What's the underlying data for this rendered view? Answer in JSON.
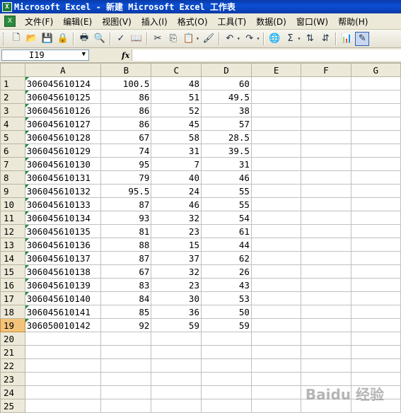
{
  "window": {
    "title": "Microsoft Excel - 新建 Microsoft Excel 工作表"
  },
  "menubar": {
    "items": [
      "文件(F)",
      "编辑(E)",
      "视图(V)",
      "插入(I)",
      "格式(O)",
      "工具(T)",
      "数据(D)",
      "窗口(W)",
      "帮助(H)"
    ]
  },
  "toolbar": {
    "buttons": [
      {
        "name": "new-icon",
        "glyph": "🗋"
      },
      {
        "name": "open-icon",
        "glyph": "📂"
      },
      {
        "name": "save-icon",
        "glyph": "💾"
      },
      {
        "name": "permission-icon",
        "glyph": "🔒"
      },
      {
        "name": "print-icon",
        "glyph": "🖶"
      },
      {
        "name": "print-preview-icon",
        "glyph": "🔍"
      },
      {
        "name": "spelling-icon",
        "glyph": "✓"
      },
      {
        "name": "research-icon",
        "glyph": "📖"
      },
      {
        "name": "cut-icon",
        "glyph": "✂"
      },
      {
        "name": "copy-icon",
        "glyph": "⎘"
      },
      {
        "name": "paste-icon",
        "glyph": "📋"
      },
      {
        "name": "format-painter-icon",
        "glyph": "🖌"
      },
      {
        "name": "undo-icon",
        "glyph": "↶"
      },
      {
        "name": "redo-icon",
        "glyph": "↷"
      },
      {
        "name": "hyperlink-icon",
        "glyph": "🌐"
      },
      {
        "name": "autosum-icon",
        "glyph": "Σ"
      },
      {
        "name": "sort-ascending-icon",
        "glyph": "⇅"
      },
      {
        "name": "sort-descending-icon",
        "glyph": "⇵"
      },
      {
        "name": "chart-wizard-icon",
        "glyph": "📊"
      },
      {
        "name": "drawing-icon",
        "glyph": "✎"
      }
    ]
  },
  "formula_bar": {
    "name_box": "I19",
    "fx_label": "fx",
    "value": ""
  },
  "sheet": {
    "columns": [
      "A",
      "B",
      "C",
      "D",
      "E",
      "F",
      "G"
    ],
    "selected_row": 19,
    "rows": [
      {
        "row": "1",
        "A": "306045610124",
        "B": "100.5",
        "C": "48",
        "D": "60"
      },
      {
        "row": "2",
        "A": "306045610125",
        "B": "86",
        "C": "51",
        "D": "49.5"
      },
      {
        "row": "3",
        "A": "306045610126",
        "B": "86",
        "C": "52",
        "D": "38"
      },
      {
        "row": "4",
        "A": "306045610127",
        "B": "86",
        "C": "45",
        "D": "57"
      },
      {
        "row": "5",
        "A": "306045610128",
        "B": "67",
        "C": "58",
        "D": "28.5"
      },
      {
        "row": "6",
        "A": "306045610129",
        "B": "74",
        "C": "31",
        "D": "39.5"
      },
      {
        "row": "7",
        "A": "306045610130",
        "B": "95",
        "C": "7",
        "D": "31"
      },
      {
        "row": "8",
        "A": "306045610131",
        "B": "79",
        "C": "40",
        "D": "46"
      },
      {
        "row": "9",
        "A": "306045610132",
        "B": "95.5",
        "C": "24",
        "D": "55"
      },
      {
        "row": "10",
        "A": "306045610133",
        "B": "87",
        "C": "46",
        "D": "55"
      },
      {
        "row": "11",
        "A": "306045610134",
        "B": "93",
        "C": "32",
        "D": "54"
      },
      {
        "row": "12",
        "A": "306045610135",
        "B": "81",
        "C": "23",
        "D": "61"
      },
      {
        "row": "13",
        "A": "306045610136",
        "B": "88",
        "C": "15",
        "D": "44"
      },
      {
        "row": "14",
        "A": "306045610137",
        "B": "87",
        "C": "37",
        "D": "62"
      },
      {
        "row": "15",
        "A": "306045610138",
        "B": "67",
        "C": "32",
        "D": "26"
      },
      {
        "row": "16",
        "A": "306045610139",
        "B": "83",
        "C": "23",
        "D": "43"
      },
      {
        "row": "17",
        "A": "306045610140",
        "B": "84",
        "C": "30",
        "D": "53"
      },
      {
        "row": "18",
        "A": "306045610141",
        "B": "85",
        "C": "36",
        "D": "50"
      },
      {
        "row": "19",
        "A": "306050010142",
        "B": "92",
        "C": "59",
        "D": "59"
      },
      {
        "row": "20",
        "A": "",
        "B": "",
        "C": "",
        "D": ""
      },
      {
        "row": "21",
        "A": "",
        "B": "",
        "C": "",
        "D": ""
      },
      {
        "row": "22",
        "A": "",
        "B": "",
        "C": "",
        "D": ""
      },
      {
        "row": "23",
        "A": "",
        "B": "",
        "C": "",
        "D": ""
      },
      {
        "row": "24",
        "A": "",
        "B": "",
        "C": "",
        "D": ""
      },
      {
        "row": "25",
        "A": "",
        "B": "",
        "C": "",
        "D": ""
      }
    ]
  },
  "watermark": "Baidu 经验",
  "colors": {
    "title_bar": "#0b4fd6",
    "chrome": "#ece9d8",
    "selected_row_header": "#f3c37a",
    "text_number_flag": "#1d8a3a"
  }
}
